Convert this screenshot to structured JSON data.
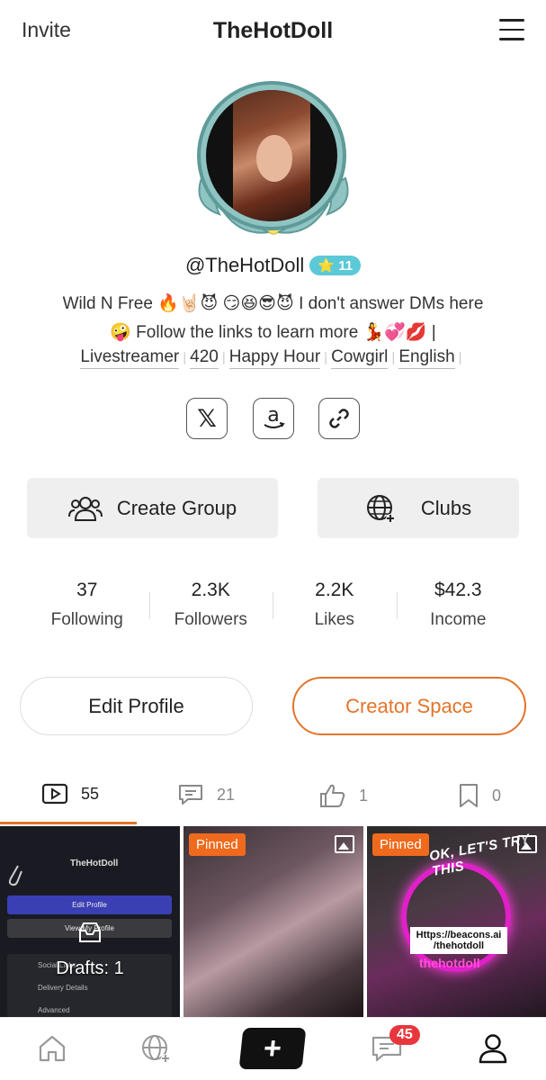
{
  "header": {
    "invite_label": "Invite",
    "title": "TheHotDoll",
    "menu_icon": "hamburger-menu-icon"
  },
  "profile": {
    "username": "@TheHotDoll",
    "level": "11",
    "bio": "Wild N Free 🔥🤘🏻😈 😏😆😎😈 I don't answer DMs here 🤪 Follow the links to learn more 💃💞💋 |",
    "tags": [
      "Livestreamer",
      "420",
      "Happy Hour",
      "Cowgirl",
      "English"
    ],
    "social_icons": [
      "x-icon",
      "amazon-icon",
      "link-icon"
    ]
  },
  "actions": {
    "create_group": "Create Group",
    "clubs": "Clubs"
  },
  "stats": [
    {
      "value": "37",
      "label": "Following"
    },
    {
      "value": "2.3K",
      "label": "Followers"
    },
    {
      "value": "2.2K",
      "label": "Likes"
    },
    {
      "value": "$42.3",
      "label": "Income"
    }
  ],
  "buttons": {
    "edit_profile": "Edit Profile",
    "creator_space": "Creator Space"
  },
  "content_tabs": [
    {
      "icon": "video-icon",
      "count": "55"
    },
    {
      "icon": "comment-icon",
      "count": "21"
    },
    {
      "icon": "thumbs-up-icon",
      "count": "1"
    },
    {
      "icon": "bookmark-icon",
      "count": "0"
    }
  ],
  "grid": {
    "tile1": {
      "drafts_label": "Drafts: 1",
      "name": "TheHotDoll",
      "edit_label": "Edit Profile",
      "view_label": "View My Profile",
      "rows": [
        "Social Links",
        "Delivery Details",
        "Advanced"
      ]
    },
    "tile2": {
      "pinned_label": "Pinned"
    },
    "tile3": {
      "pinned_label": "Pinned",
      "headline": "OK, LET'S TRY THIS",
      "link_text": "Https://beacons.ai /thehotdoll",
      "handle": "thehotdoll"
    }
  },
  "bottom_nav": {
    "messages_badge": "45"
  },
  "colors": {
    "accent": "#e3742a",
    "level_badge": "#5bc9d8",
    "pinned": "#f06a1d",
    "notification": "#e8363d"
  }
}
